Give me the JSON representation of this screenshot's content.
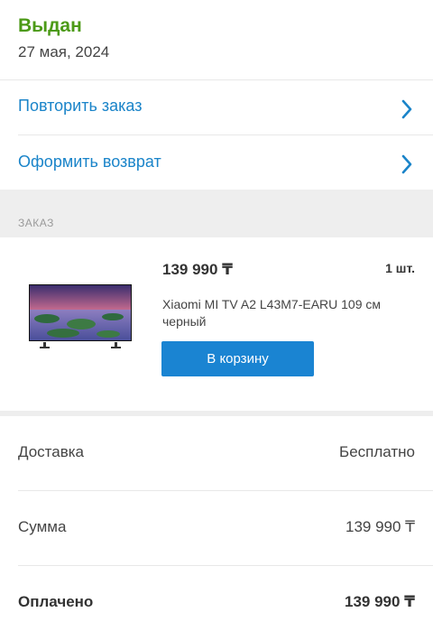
{
  "status": {
    "title": "Выдан",
    "date": "27 мая, 2024",
    "color": "#4c9a17"
  },
  "actions": [
    {
      "label": "Повторить заказ",
      "icon": "chevron-right-icon"
    },
    {
      "label": "Оформить возврат",
      "icon": "chevron-right-icon"
    }
  ],
  "order": {
    "section_label": "ЗАКАЗ",
    "item": {
      "price": "139 990 ₸",
      "quantity": "1 шт.",
      "name": "Xiaomi MI TV A2 L43M7-EARU 109 см черный",
      "image": "tv-product-image",
      "cart_button_label": "В корзину"
    }
  },
  "summary": {
    "delivery_label": "Доставка",
    "delivery_value": "Бесплатно",
    "sum_label": "Сумма",
    "sum_value": "139 990 ₸",
    "paid_label": "Оплачено",
    "paid_value": "139 990 ₸"
  },
  "colors": {
    "accent": "#1a84c9",
    "button": "#1a84d2",
    "status": "#4c9a17"
  }
}
